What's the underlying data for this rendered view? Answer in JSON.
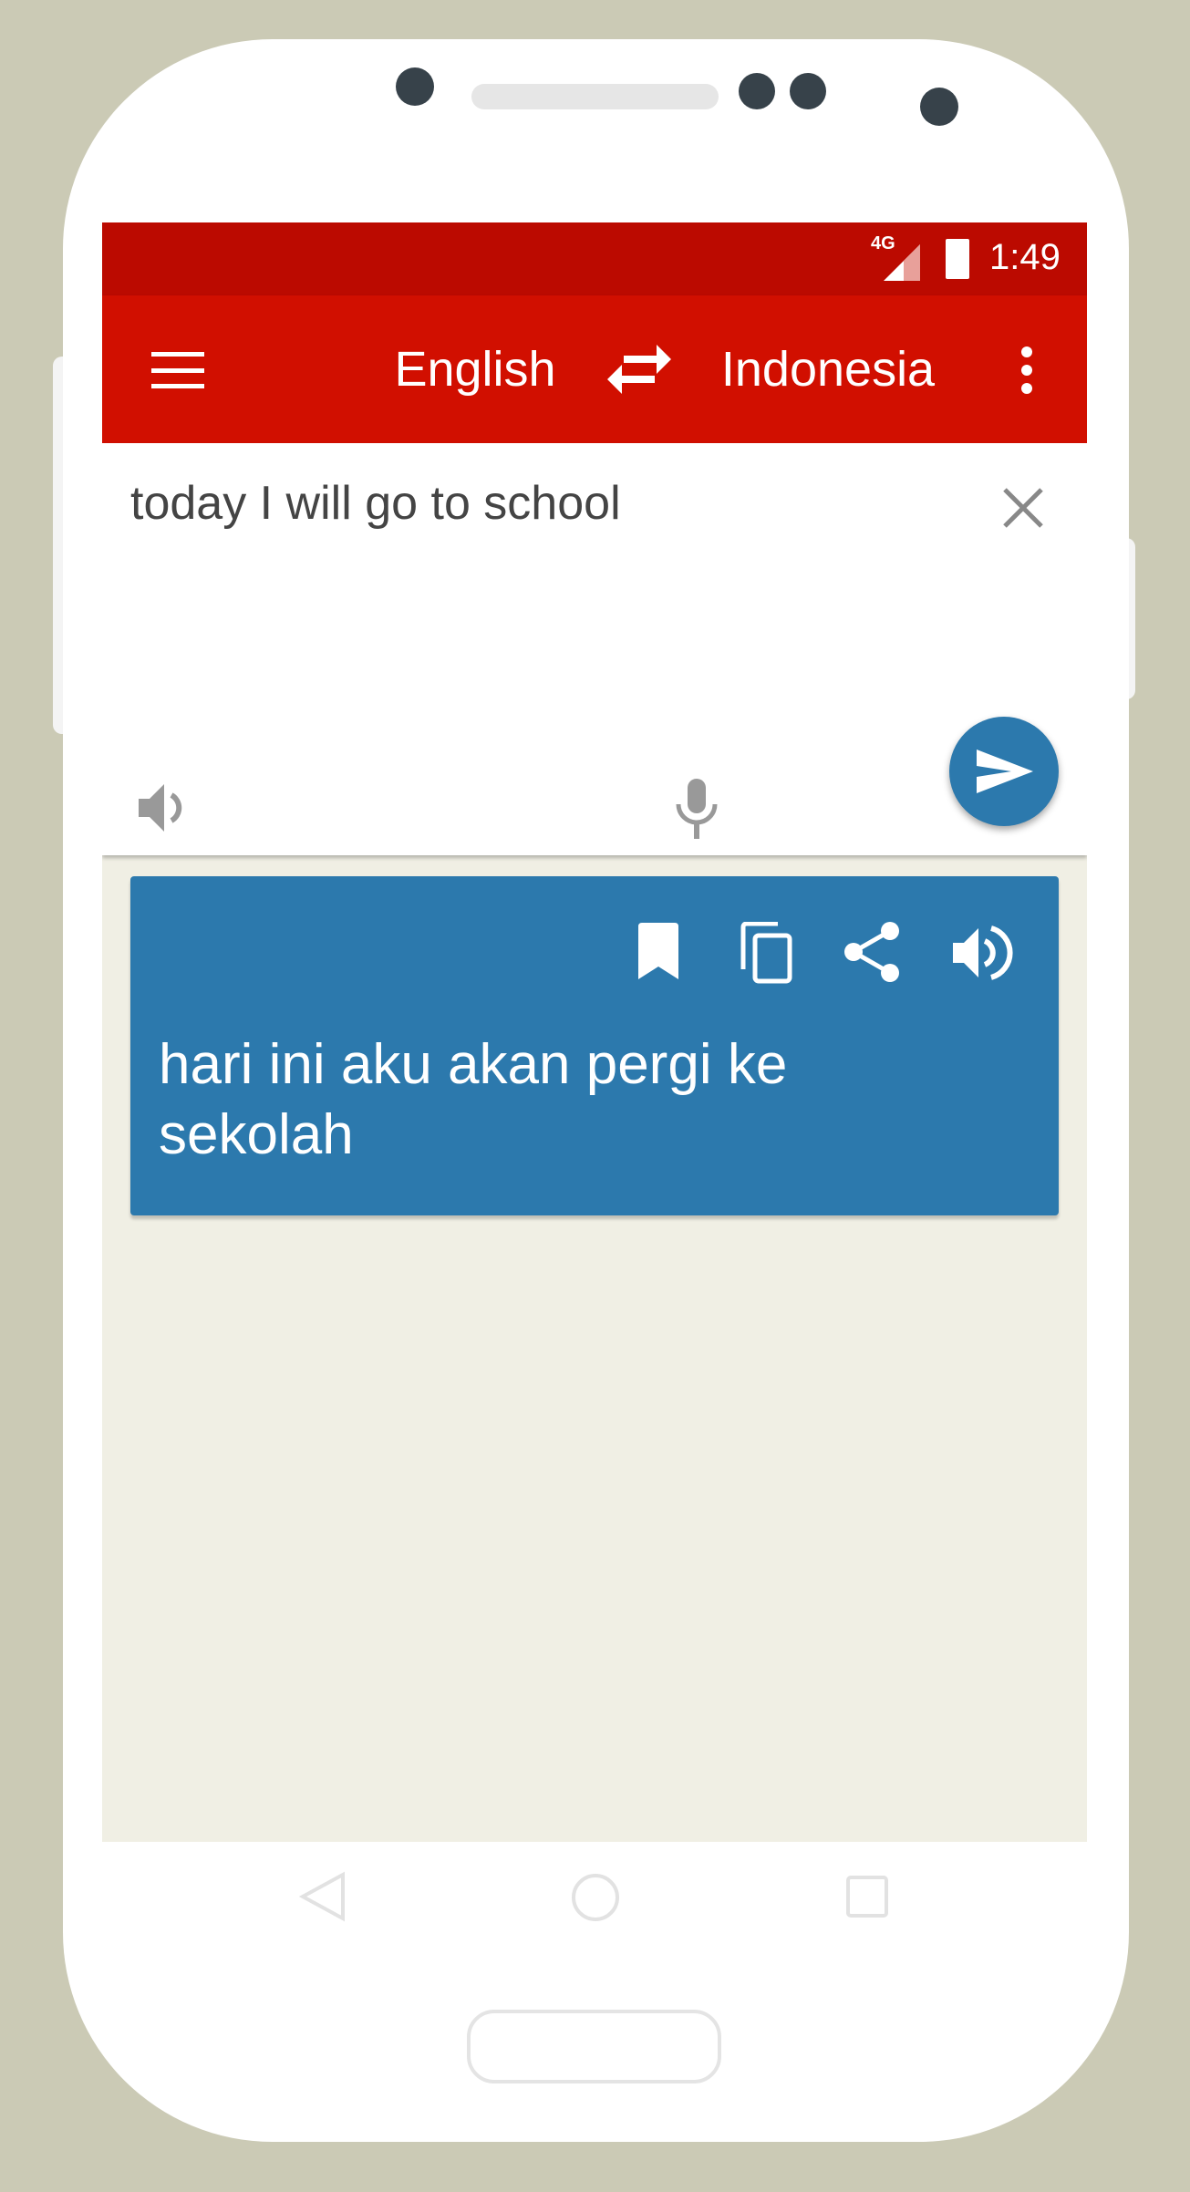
{
  "status_bar": {
    "network": "4G",
    "time": "1:49"
  },
  "toolbar": {
    "source_language": "English",
    "target_language": "Indonesia"
  },
  "input": {
    "text": "today I will go to school"
  },
  "output": {
    "translation": "hari ini aku akan pergi ke sekolah"
  },
  "colors": {
    "status_bar": "#bb0a00",
    "toolbar": "#d10f00",
    "accent": "#2c79ad",
    "background": "#f0efe4",
    "frame": "#cbcab5"
  }
}
